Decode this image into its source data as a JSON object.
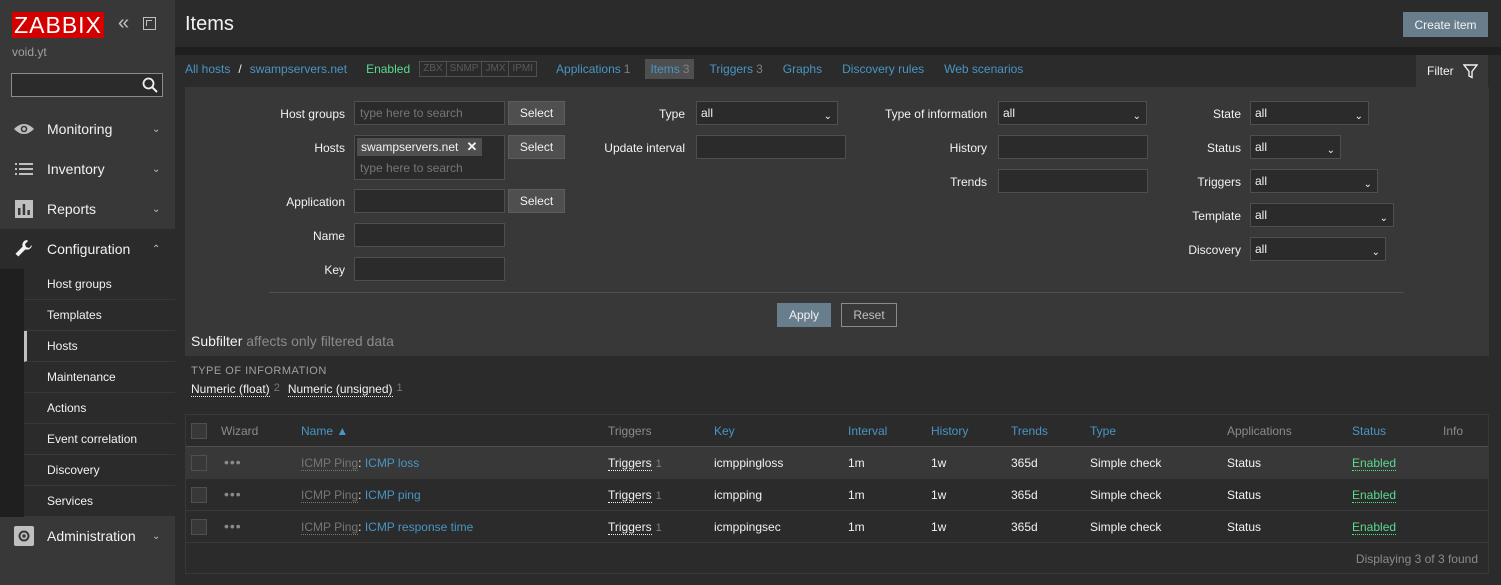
{
  "sidebar": {
    "logo": "ZABBIX",
    "server_name": "void.yt",
    "search": {
      "value": "",
      "placeholder": ""
    },
    "menu": [
      {
        "label": "Monitoring",
        "icon": "eye-icon"
      },
      {
        "label": "Inventory",
        "icon": "list-icon"
      },
      {
        "label": "Reports",
        "icon": "bar-chart-icon"
      },
      {
        "label": "Configuration",
        "icon": "wrench-icon"
      },
      {
        "label": "Administration",
        "icon": "gear-icon"
      }
    ],
    "submenu": [
      "Host groups",
      "Templates",
      "Hosts",
      "Maintenance",
      "Actions",
      "Event correlation",
      "Discovery",
      "Services"
    ],
    "selected_submenu": "Hosts"
  },
  "header": {
    "title": "Items",
    "create_button": "Create item"
  },
  "breadcrumbs": {
    "all_hosts": "All hosts",
    "separator": "/",
    "host": "swampservers.net",
    "status": "Enabled",
    "protocols": [
      "ZBX",
      "SNMP",
      "JMX",
      "IPMI"
    ],
    "tabs": [
      {
        "label": "Applications",
        "count": "1"
      },
      {
        "label": "Items",
        "count": "3"
      },
      {
        "label": "Triggers",
        "count": "3"
      },
      {
        "label": "Graphs",
        "count": ""
      },
      {
        "label": "Discovery rules",
        "count": ""
      },
      {
        "label": "Web scenarios",
        "count": ""
      }
    ]
  },
  "filter": {
    "tab_label": "Filter",
    "host_groups_label": "Host groups",
    "host_groups_placeholder": "type here to search",
    "hosts_label": "Hosts",
    "hosts_selected": "swampservers.net",
    "hosts_placeholder": "type here to search",
    "application_label": "Application",
    "name_label": "Name",
    "key_label": "Key",
    "select_button": "Select",
    "type_label": "Type",
    "type_value": "all",
    "update_interval_label": "Update interval",
    "type_of_info_label": "Type of information",
    "type_of_info_value": "all",
    "history_label": "History",
    "trends_label": "Trends",
    "state_label": "State",
    "state_value": "all",
    "status_label": "Status",
    "status_value": "all",
    "triggers_label": "Triggers",
    "triggers_value": "all",
    "template_label": "Template",
    "template_value": "all",
    "discovery_label": "Discovery",
    "discovery_value": "all",
    "apply_button": "Apply",
    "reset_button": "Reset"
  },
  "subfilter": {
    "title": "Subfilter",
    "note": "affects only filtered data",
    "heading": "TYPE OF INFORMATION",
    "options": [
      {
        "label": "Numeric (float)",
        "count": "2"
      },
      {
        "label": "Numeric (unsigned)",
        "count": "1"
      }
    ]
  },
  "table": {
    "columns": {
      "wizard": "Wizard",
      "name": "Name ▲",
      "triggers": "Triggers",
      "key": "Key",
      "interval": "Interval",
      "history": "History",
      "trends": "Trends",
      "type": "Type",
      "applications": "Applications",
      "status": "Status",
      "info": "Info"
    },
    "rows": [
      {
        "template": "ICMP Ping",
        "name": "ICMP loss",
        "triggers": "Triggers",
        "triggers_count": "1",
        "key": "icmppingloss",
        "interval": "1m",
        "history": "1w",
        "trends": "365d",
        "type": "Simple check",
        "applications": "Status",
        "status": "Enabled"
      },
      {
        "template": "ICMP Ping",
        "name": "ICMP ping",
        "triggers": "Triggers",
        "triggers_count": "1",
        "key": "icmpping",
        "interval": "1m",
        "history": "1w",
        "trends": "365d",
        "type": "Simple check",
        "applications": "Status",
        "status": "Enabled"
      },
      {
        "template": "ICMP Ping",
        "name": "ICMP response time",
        "triggers": "Triggers",
        "triggers_count": "1",
        "key": "icmppingsec",
        "interval": "1m",
        "history": "1w",
        "trends": "365d",
        "type": "Simple check",
        "applications": "Status",
        "status": "Enabled"
      }
    ],
    "footer": "Displaying 3 of 3 found"
  }
}
